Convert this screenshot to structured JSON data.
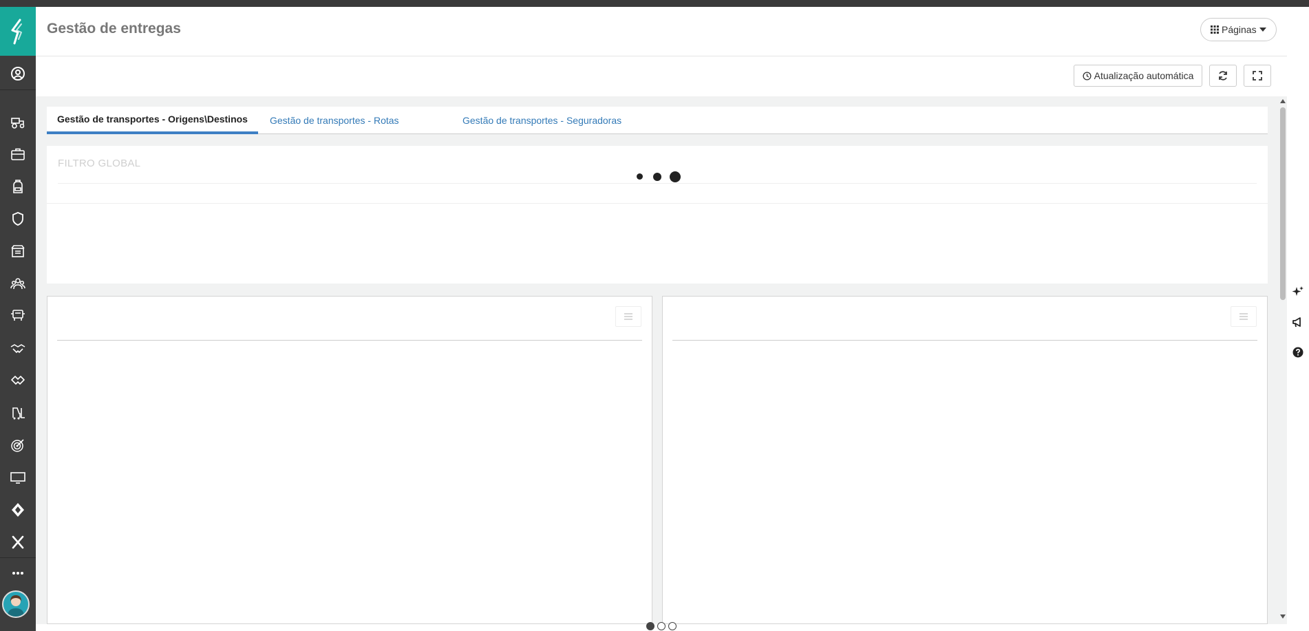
{
  "header": {
    "title": "Gestão de entregas",
    "pages_button": "Páginas"
  },
  "toolbar": {
    "auto_update_label": "Atualização automática"
  },
  "tabs": [
    {
      "label": "Gestão de transportes - Origens\\Destinos",
      "active": true
    },
    {
      "label": "Gestão de transportes - Rotas",
      "active": false
    },
    {
      "label": "Gestão de transportes - Seguradoras",
      "active": false
    }
  ],
  "filter": {
    "title": "FILTRO GLOBAL"
  },
  "pager": {
    "count": 3,
    "current": 1
  },
  "colors": {
    "brand": "#18a99a",
    "sidebar": "#3d3d3d",
    "tab_active": "#3d7fc4",
    "link": "#337ab7"
  },
  "sidebar": {
    "icons": [
      "user-circle-icon",
      "tractor-icon",
      "briefcase-icon",
      "backpack-icon",
      "shield-icon",
      "archive-box-icon",
      "team-icon",
      "truck-icon",
      "handshake-icon",
      "deal-icon",
      "forklift-icon",
      "target-icon",
      "monitor-icon",
      "cube-icon",
      "close-x-icon",
      "more-icon",
      "avatar"
    ]
  },
  "rightrail": {
    "icons": [
      "sparkle-icon",
      "megaphone-icon",
      "help-icon"
    ]
  }
}
